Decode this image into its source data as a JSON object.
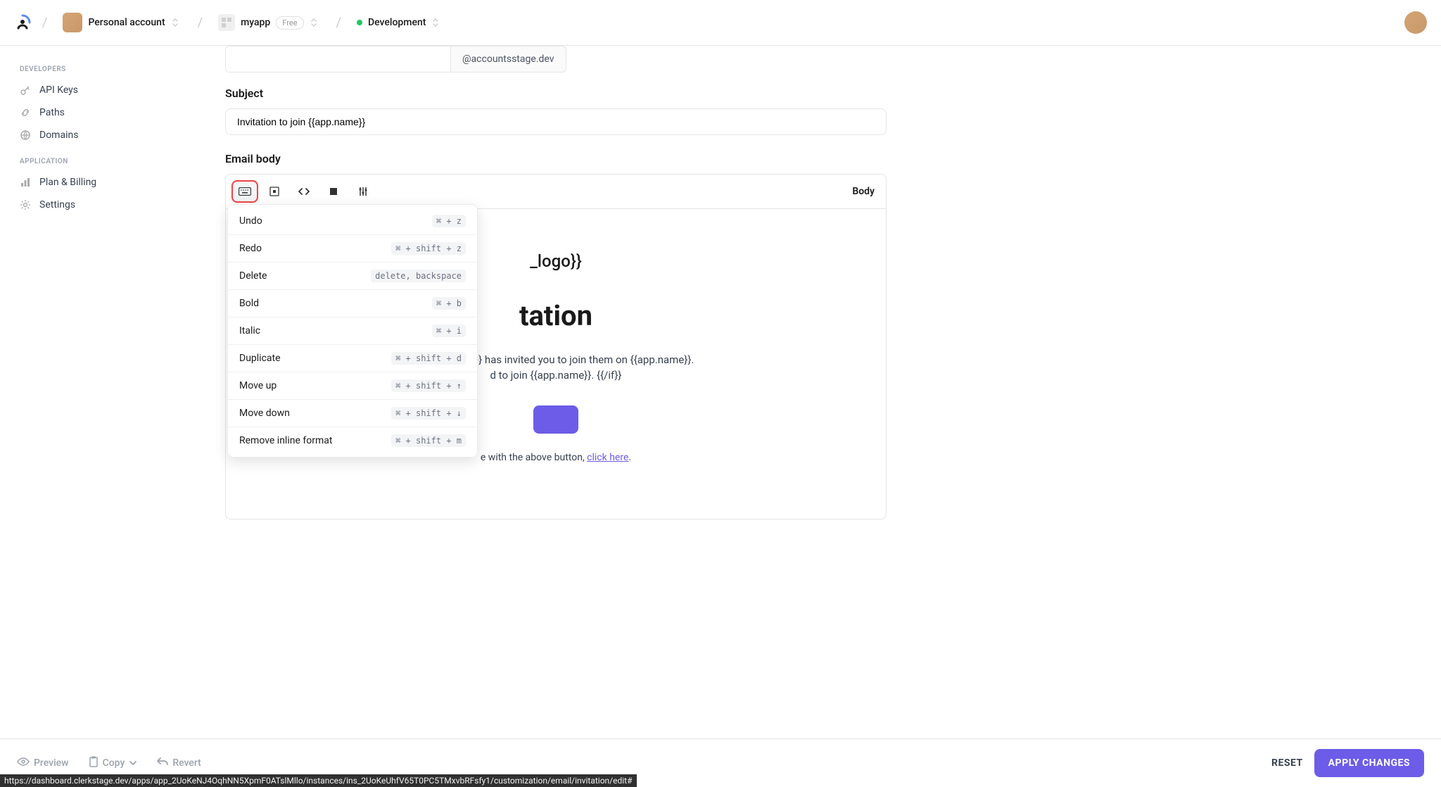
{
  "header": {
    "account_label": "Personal account",
    "app_name": "myapp",
    "plan_badge": "Free",
    "environment": "Development"
  },
  "sidebar": {
    "section_dev": "Developers",
    "section_app": "Application",
    "items_dev": [
      {
        "label": "API Keys"
      },
      {
        "label": "Paths"
      },
      {
        "label": "Domains"
      }
    ],
    "items_app": [
      {
        "label": "Plan & Billing"
      },
      {
        "label": "Settings"
      }
    ]
  },
  "form": {
    "domain_suffix": "@accountsstage.dev",
    "subject_label": "Subject",
    "subject_value": "Invitation to join {{app.name}}",
    "body_label": "Email body",
    "toolbar_mode": "Body"
  },
  "email_preview": {
    "logo_text": "_logo}}",
    "heading": "tation",
    "line1": "nviter_name}} has invited you to join them on {{app.name}}.",
    "line2": "d to join {{app.name}}. {{/if}}",
    "help_prefix": "e with the above button, ",
    "help_link": "click here",
    "help_suffix": "."
  },
  "menu": {
    "items": [
      {
        "label": "Undo",
        "shortcut": "⌘ + z"
      },
      {
        "label": "Redo",
        "shortcut": "⌘ + shift + z"
      },
      {
        "label": "Delete",
        "shortcut": "delete, backspace"
      },
      {
        "label": "Bold",
        "shortcut": "⌘ + b"
      },
      {
        "label": "Italic",
        "shortcut": "⌘ + i"
      },
      {
        "label": "Duplicate",
        "shortcut": "⌘ + shift + d"
      },
      {
        "label": "Move up",
        "shortcut": "⌘ + shift + ↑"
      },
      {
        "label": "Move down",
        "shortcut": "⌘ + shift + ↓"
      },
      {
        "label": "Remove inline format",
        "shortcut": "⌘ + shift + m"
      }
    ]
  },
  "footer": {
    "preview": "Preview",
    "copy": "Copy",
    "revert": "Revert",
    "reset": "RESET",
    "apply": "APPLY CHANGES"
  },
  "status_url": "https://dashboard.clerkstage.dev/apps/app_2UoKeNJ4OqhNN5XpmF0ATslMllo/instances/ins_2UoKeUhfV65T0PC5TMxvbRFsfy1/customization/email/invitation/edit#",
  "colors": {
    "accent": "#6d5ce8",
    "highlight": "#ef4444",
    "env_green": "#22c55e"
  }
}
